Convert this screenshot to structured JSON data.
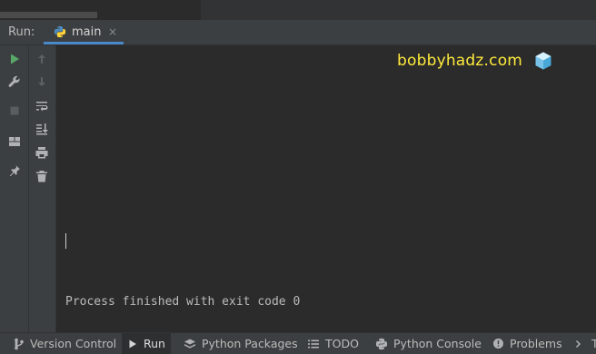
{
  "run_panel": {
    "label": "Run:",
    "tab": {
      "label": "main",
      "close": "×",
      "icon": "python-icon"
    }
  },
  "left_toolbar": [
    "run-icon",
    "wrench-icon",
    "stop-icon",
    "layout-icon",
    "pin-icon"
  ],
  "left_toolbar2": [
    "up-arrow-icon",
    "down-arrow-icon",
    "soft-wrap-icon",
    "scroll-to-end-icon",
    "print-icon",
    "trash-icon"
  ],
  "console": {
    "watermark": "bobbyhadz.com",
    "process_message": "Process finished with exit code 0"
  },
  "bottom_bar": {
    "version_control": "Version Control",
    "run": "Run",
    "python_packages": "Python Packages",
    "todo": "TODO",
    "python_console": "Python Console",
    "problems": "Problems",
    "terminal_clipped": "T"
  },
  "colors": {
    "accent": "#4a88c7",
    "run_green": "#59a869",
    "watermark": "#ffeb3b",
    "panel": "#3c3f41",
    "console_bg": "#2b2b2b"
  }
}
